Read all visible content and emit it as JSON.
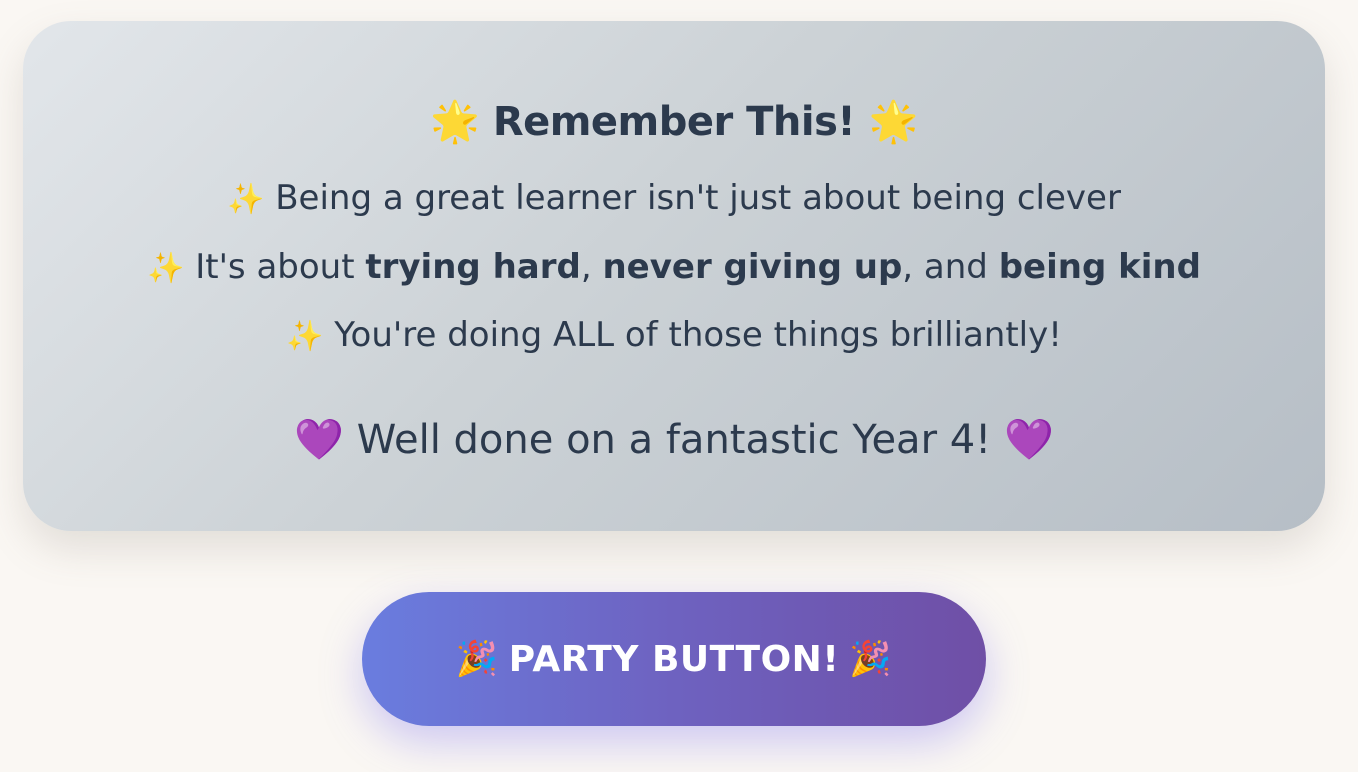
{
  "card": {
    "title": "Remember This!",
    "title_icon": "glowing-star-icon",
    "line_icon": "sparkles-icon",
    "line1": "Being a great learner isn't just about being clever",
    "line2": {
      "prefix": "It's about ",
      "bold1": "trying hard",
      "sep1": ", ",
      "bold2": "never giving up",
      "sep2": ", and ",
      "bold3": "being kind"
    },
    "line3": "You're doing ALL of those things brilliantly!",
    "closing": "Well done on a fantastic Year 4!",
    "closing_icon": "purple-heart-icon"
  },
  "party_button": {
    "label": "PARTY BUTTON!",
    "icon": "party-popper-icon"
  },
  "colors": {
    "page_background": "#faf7f3",
    "card_text": "#2c3a4d",
    "button_gradient_start": "#6a7ddf",
    "button_gradient_end": "#6f4fa6",
    "button_text": "#ffffff"
  }
}
